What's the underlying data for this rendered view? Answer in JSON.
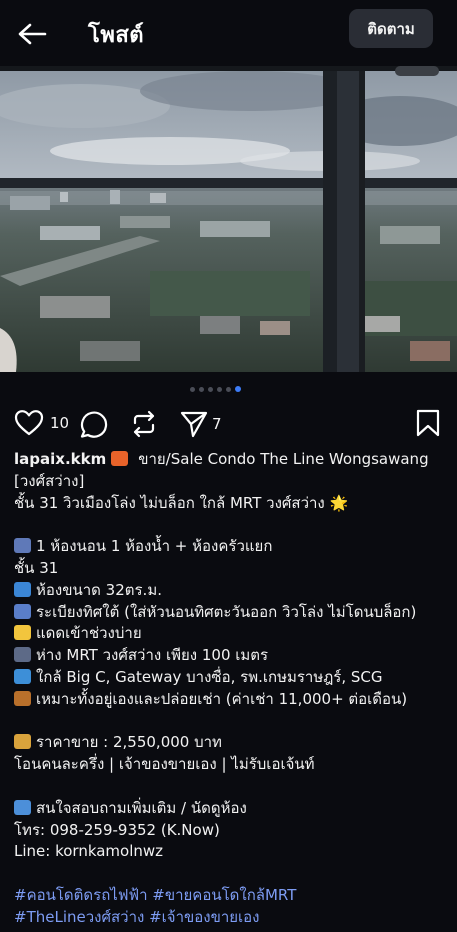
{
  "header": {
    "title": "โพสต์",
    "follow_label": "ติดตาม"
  },
  "carousel": {
    "total": 6,
    "active_index": 5
  },
  "actions": {
    "like_count": "10",
    "share_count": "7"
  },
  "caption": {
    "username": "lapaix.kkm",
    "lines": [
      {
        "emoji": "sunset-emoji",
        "color": "#e8632a",
        "text": " ขาย/Sale Condo The Line Wongsawang"
      },
      {
        "text": "[วงศ์สว่าง]"
      },
      {
        "text": " ชั้น 31 วิวเมืองโล่ง ไม่บล็อก ใกล้ MRT วงศ์สว่าง 🌟"
      },
      {
        "blank": true
      },
      {
        "emoji": "bed-emoji",
        "color": "#5f79b8",
        "text": "1 ห้องนอน 1 ห้องน้ำ + ห้องครัวแยก"
      },
      {
        "text": "ชั้น 31"
      },
      {
        "emoji": "cityscape-emoji",
        "color": "#3b86d6",
        "text": "ห้องขนาด 32ตร.ม."
      },
      {
        "emoji": "city-sunrise-emoji",
        "color": "#5a7ec9",
        "text": "ระเบียงทิศใต้ (ใส่หัวนอนทิศตะวันออก วิวโล่ง ไม่โดนบล็อก)"
      },
      {
        "emoji": "sparkles-emoji",
        "color": "#f2c53d",
        "text": "แดดเข้าช่วงบ่าย"
      },
      {
        "emoji": "metro-emoji",
        "color": "#5d6a87",
        "text": "ห่าง MRT วงศ์สว่าง เพียง 100 เมตร"
      },
      {
        "emoji": "shopping-cart-emoji",
        "color": "#3d8fd8",
        "text": "ใกล้ Big C, Gateway บางซื่อ, รพ.เกษมราษฎร์, SCG"
      },
      {
        "emoji": "briefcase-emoji",
        "color": "#b9702b",
        "text": "เหมาะทั้งอยู่เองและปล่อยเช่า (ค่าเช่า 11,000+ ต่อเดือน)"
      },
      {
        "blank": true
      },
      {
        "emoji": "money-bag-emoji",
        "color": "#d9a33c",
        "text": "ราคาขาย :  2,550,000 บาท"
      },
      {
        "text": "โอนคนละครึ่ง | เจ้าของขายเอง | ไม่รับเอเจ้นท์"
      },
      {
        "blank": true
      },
      {
        "emoji": "phone-arrow-emoji",
        "color": "#4c8fd9",
        "text": "สนใจสอบถามเพิ่มเติม / นัดดูห้อง"
      },
      {
        "text": "โทร: 098-259-9352 (K.Now)"
      },
      {
        "text": "Line: kornkamolnwz"
      },
      {
        "blank": true
      },
      {
        "tag": true,
        "text": "#คอนโดติดรถไฟฟ้า #ขายคอนโดใกล้MRT"
      },
      {
        "tag": true,
        "text": "#TheLineวงศ์สว่าง #เจ้าของขายเอง"
      }
    ]
  }
}
